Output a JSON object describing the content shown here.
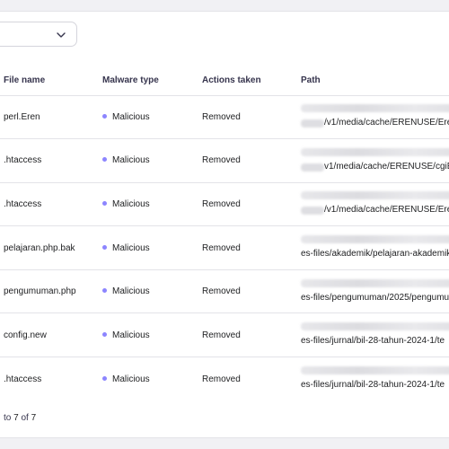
{
  "filter": {
    "selected": ""
  },
  "table": {
    "headers": {
      "file_name": "File name",
      "malware_type": "Malware type",
      "actions_taken": "Actions taken",
      "path": "Path"
    },
    "rows": [
      {
        "file_name": "perl.Eren",
        "malware_type": "Malicious",
        "action": "Removed",
        "path": "/v1/media/cache/ERENUSE/Erenl"
      },
      {
        "file_name": ".htaccess",
        "malware_type": "Malicious",
        "action": "Removed",
        "path": "v1/media/cache/ERENUSE/cgiEr"
      },
      {
        "file_name": ".htaccess",
        "malware_type": "Malicious",
        "action": "Removed",
        "path": "/v1/media/cache/ERENUSE/Erenl"
      },
      {
        "file_name": "pelajaran.php.bak",
        "malware_type": "Malicious",
        "action": "Removed",
        "path": "es-files/akademik/pelajaran-akademik"
      },
      {
        "file_name": "pengumuman.php",
        "malware_type": "Malicious",
        "action": "Removed",
        "path": "es-files/pengumuman/2025/pengumu"
      },
      {
        "file_name": "config.new",
        "malware_type": "Malicious",
        "action": "Removed",
        "path": "es-files/jurnal/bil-28-tahun-2024-1/te"
      },
      {
        "file_name": ".htaccess",
        "malware_type": "Malicious",
        "action": "Removed",
        "path": "es-files/jurnal/bil-28-tahun-2024-1/te"
      }
    ]
  },
  "pagination": {
    "prefix": "to",
    "range_end": "7",
    "of_label": "of",
    "total": "7"
  },
  "colors": {
    "malicious_dot": "#8c85ff",
    "border": "#e3e3e8",
    "background": "#f1f1f4"
  },
  "icons": {
    "dropdown": "chevron-down-icon"
  }
}
